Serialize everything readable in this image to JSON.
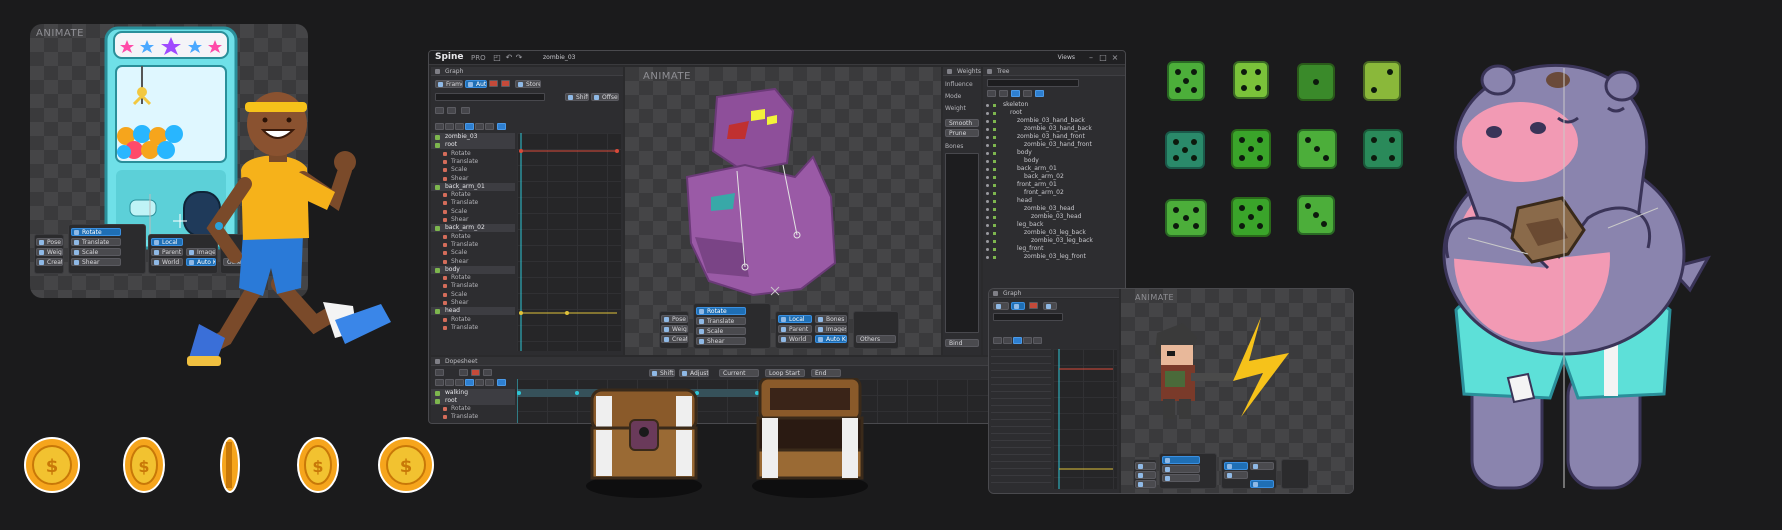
{
  "left_panel": {
    "label": "ANIMATE",
    "tools": {
      "pose": "Pose",
      "weights": "Weights",
      "create": "Create",
      "rotate": "Rotate",
      "translate": "Translate",
      "scale": "Scale",
      "shear": "Shear",
      "local": "Local",
      "parent": "Parent",
      "world": "World",
      "auto_key": "Auto Key",
      "images": "Images",
      "others": "Others"
    }
  },
  "spine_window": {
    "logo": "Spine",
    "edition": "PRO",
    "project": "zombie_03",
    "views_label": "Views",
    "graph_panel": {
      "title": "Graph",
      "frame": "Frame",
      "auto": "Auto",
      "store": "Store",
      "shift": "Shift",
      "offset": "Offset",
      "tree_rows": [
        {
          "label": "zombie_03",
          "kind": "hdr"
        },
        {
          "label": "root",
          "kind": "hdr"
        },
        {
          "label": "Rotate",
          "kind": "sub"
        },
        {
          "label": "Translate",
          "kind": "sub"
        },
        {
          "label": "Scale",
          "kind": "sub"
        },
        {
          "label": "Shear",
          "kind": "sub"
        },
        {
          "label": "back_arm_01",
          "kind": "hdr"
        },
        {
          "label": "Rotate",
          "kind": "sub"
        },
        {
          "label": "Translate",
          "kind": "sub"
        },
        {
          "label": "Scale",
          "kind": "sub"
        },
        {
          "label": "Shear",
          "kind": "sub"
        },
        {
          "label": "back_arm_02",
          "kind": "hdr"
        },
        {
          "label": "Rotate",
          "kind": "sub"
        },
        {
          "label": "Translate",
          "kind": "sub"
        },
        {
          "label": "Scale",
          "kind": "sub"
        },
        {
          "label": "Shear",
          "kind": "sub"
        },
        {
          "label": "body",
          "kind": "hdr"
        },
        {
          "label": "Rotate",
          "kind": "sub"
        },
        {
          "label": "Translate",
          "kind": "sub"
        },
        {
          "label": "Scale",
          "kind": "sub"
        },
        {
          "label": "Shear",
          "kind": "sub"
        },
        {
          "label": "head",
          "kind": "hdr"
        },
        {
          "label": "Rotate",
          "kind": "sub"
        },
        {
          "label": "Translate",
          "kind": "sub"
        }
      ]
    },
    "viewport_label": "ANIMATE",
    "weights_panel": {
      "title": "Weights",
      "influence": "Influence",
      "mode": "Mode",
      "weight": "Weight",
      "smooth": "Smooth",
      "prune": "Prune",
      "bones": "Bones",
      "bind": "Bind"
    },
    "tree_panel": {
      "title": "Tree",
      "rows": [
        {
          "label": "skeleton",
          "depth": 0
        },
        {
          "label": "root",
          "depth": 1
        },
        {
          "label": "zombie_03_hand_back",
          "depth": 2
        },
        {
          "label": "zombie_03_hand_back",
          "depth": 3
        },
        {
          "label": "zombie_03_hand_front",
          "depth": 2
        },
        {
          "label": "zombie_03_hand_front",
          "depth": 3
        },
        {
          "label": "body",
          "depth": 2
        },
        {
          "label": "body",
          "depth": 3
        },
        {
          "label": "back_arm_01",
          "depth": 2
        },
        {
          "label": "back_arm_02",
          "depth": 3
        },
        {
          "label": "front_arm_01",
          "depth": 2
        },
        {
          "label": "front_arm_02",
          "depth": 3
        },
        {
          "label": "head",
          "depth": 2
        },
        {
          "label": "zombie_03_head",
          "depth": 3
        },
        {
          "label": "zombie_03_head",
          "depth": 4
        },
        {
          "label": "leg_back",
          "depth": 2
        },
        {
          "label": "zombie_03_leg_back",
          "depth": 3
        },
        {
          "label": "zombie_03_leg_back",
          "depth": 4
        },
        {
          "label": "leg_front",
          "depth": 2
        },
        {
          "label": "zombie_03_leg_front",
          "depth": 3
        }
      ]
    },
    "tools": {
      "pose": "Pose",
      "weights": "Weights",
      "create": "Create",
      "rotate": "Rotate",
      "translate": "Translate",
      "scale": "Scale",
      "shear": "Shear",
      "local": "Local",
      "parent": "Parent",
      "world": "World",
      "bones": "Bones",
      "images": "Images",
      "auto_key": "Auto Key",
      "others": "Others"
    },
    "dopesheet": {
      "title": "Dopesheet",
      "shift": "Shift",
      "adjust": "Adjust",
      "current": "Current",
      "loop_start": "Loop Start",
      "end": "End",
      "rows": [
        "walking",
        "root",
        "Rotate",
        "Translate"
      ]
    }
  },
  "small_window": {
    "graph_title": "Graph",
    "viewport_label": "ANIMATE"
  },
  "colors": {
    "background": "#1b1b1c",
    "accent_blue": "#2e7fd0",
    "keyframe_red": "#d94a3a",
    "keyframe_yellow": "#e0c23a",
    "playhead_cyan": "#2fc6d6"
  }
}
